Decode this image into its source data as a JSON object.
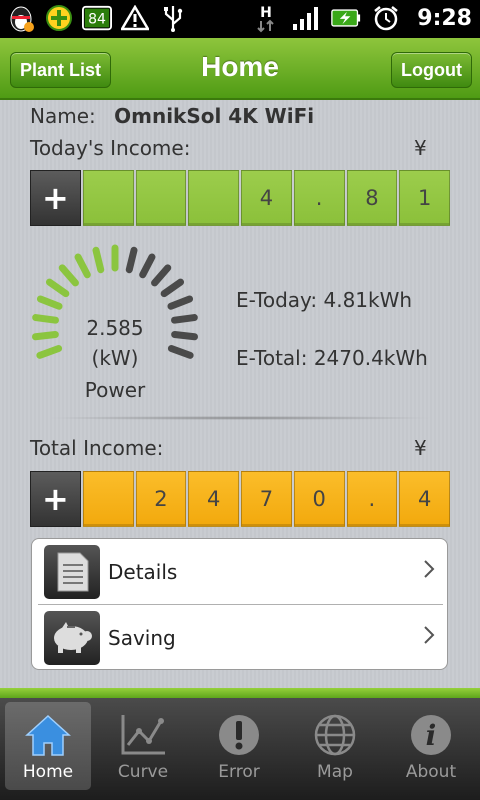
{
  "status_bar": {
    "battery_level": "84",
    "time": "9:28",
    "network_label": "H"
  },
  "header": {
    "left_button": "Plant List",
    "title": "Home",
    "right_button": "Logout"
  },
  "plant": {
    "name_label": "Name:",
    "name_value": "OmnikSol 4K WiFi"
  },
  "today_income": {
    "label": "Today's Income:",
    "currency": "¥",
    "sign": "+",
    "digits": [
      "",
      "",
      "",
      "4",
      ".",
      "8",
      "1"
    ],
    "color": "#8bc03a"
  },
  "gauge": {
    "value": "2.585",
    "unit": "(kW)",
    "label": "Power",
    "active_color": "#8bc53f",
    "inactive_color": "#4a4a4a"
  },
  "energy": {
    "e_today": "E-Today: 4.81kWh",
    "e_total": "E-Total: 2470.4kWh"
  },
  "total_income": {
    "label": "Total Income:",
    "currency": "¥",
    "sign": "+",
    "digits": [
      "",
      "2",
      "4",
      "7",
      "0",
      ".",
      "4"
    ],
    "color": "#f2a90d"
  },
  "menu": [
    {
      "label": "Details",
      "icon": "document-icon"
    },
    {
      "label": "Saving",
      "icon": "piggy-bank-icon"
    }
  ],
  "tabs": [
    {
      "label": "Home",
      "icon": "home-icon",
      "active": true
    },
    {
      "label": "Curve",
      "icon": "chart-curve-icon",
      "active": false
    },
    {
      "label": "Error",
      "icon": "error-icon",
      "active": false
    },
    {
      "label": "Map",
      "icon": "globe-icon",
      "active": false
    },
    {
      "label": "About",
      "icon": "info-icon",
      "active": false
    }
  ],
  "colors": {
    "brand_green": "#5ea61b",
    "income_green": "#8bc03a",
    "income_yellow": "#f2a90d"
  }
}
